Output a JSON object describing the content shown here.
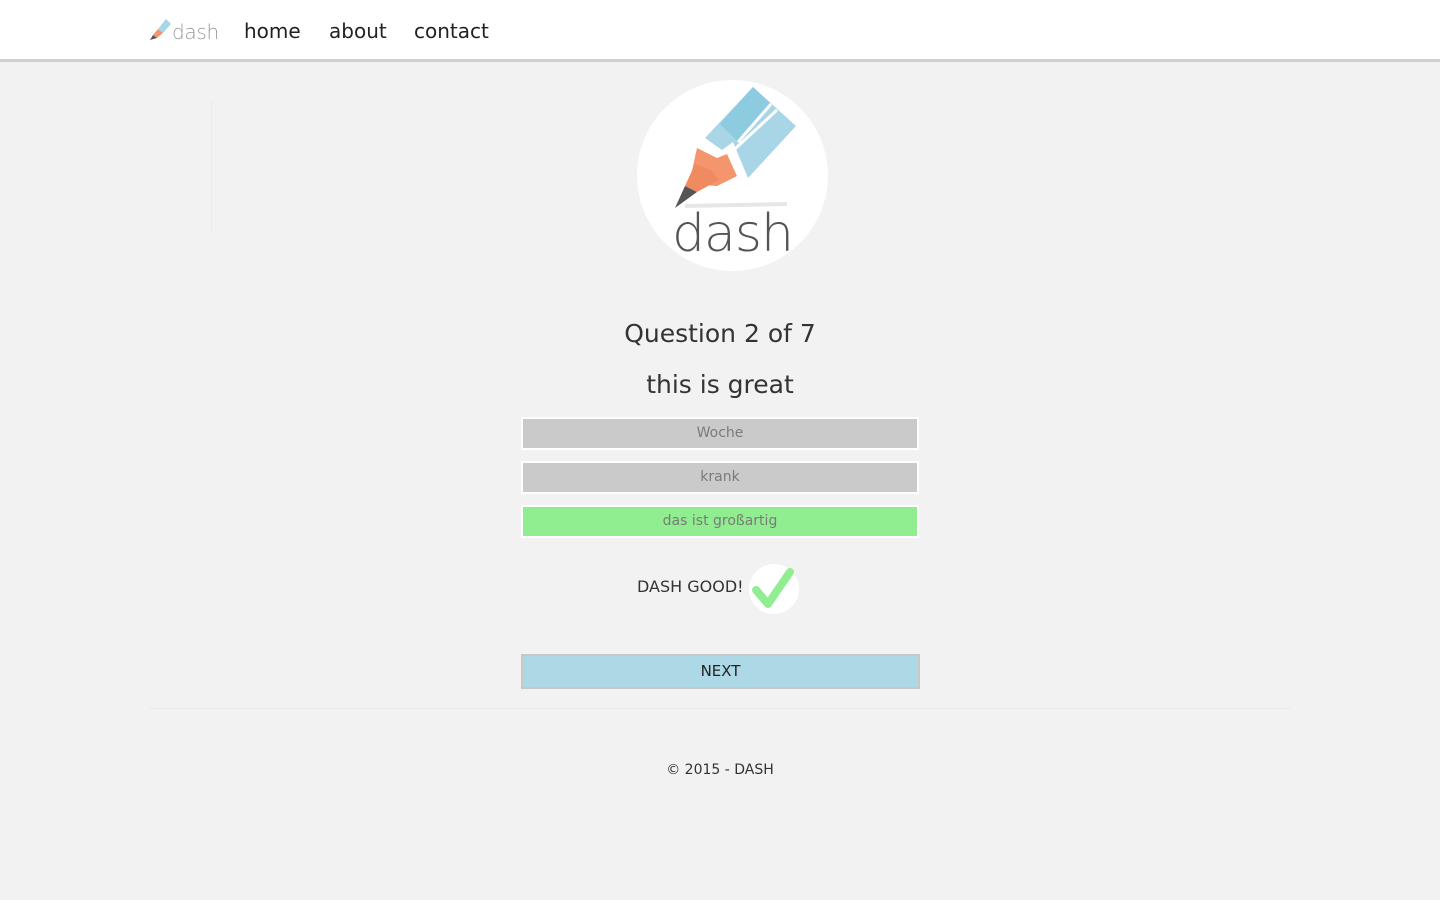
{
  "nav": {
    "brand": "dash",
    "links": [
      "home",
      "about",
      "contact"
    ]
  },
  "logo": {
    "word": "dash"
  },
  "quiz": {
    "counter": "Question 2 of 7",
    "prompt": "this is great",
    "answers": [
      {
        "label": "Woche",
        "state": "neutral"
      },
      {
        "label": "krank",
        "state": "neutral"
      },
      {
        "label": "das ist großartig",
        "state": "correct"
      }
    ],
    "feedback": "DASH GOOD!",
    "feedback_icon": "checkmark-icon",
    "next_label": "NEXT"
  },
  "footer": {
    "text": "© 2015 - DASH"
  },
  "colors": {
    "page_background": "#f2f2f2",
    "neutral_answer": "#cacaca",
    "correct_answer": "#90ee90",
    "next_button": "#add8e6",
    "check": "#90ee90",
    "pencil_blue": "#a8d6e6",
    "pencil_orange": "#f4956e"
  }
}
